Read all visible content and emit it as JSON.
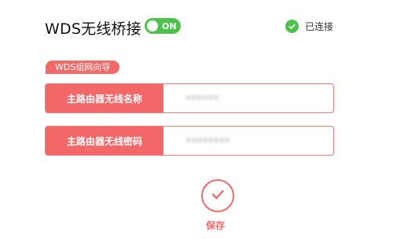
{
  "header": {
    "title": "WDS无线桥接",
    "toggle_label": "ON",
    "status_text": "已连接"
  },
  "wizard": {
    "badge": "WDS组网向导"
  },
  "fields": {
    "ssid": {
      "label": "主路由器无线名称",
      "value": "••••••"
    },
    "password": {
      "label": "主路由器无线密码",
      "value": "••••••••"
    }
  },
  "actions": {
    "save_label": "保存"
  },
  "colors": {
    "accent": "#f06a6a",
    "success": "#4cc14c"
  },
  "icons": {
    "status": "check-circle-icon",
    "save": "checkmark-icon"
  }
}
